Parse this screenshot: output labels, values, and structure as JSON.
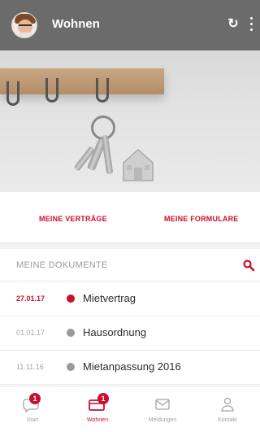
{
  "appbar": {
    "title": "Wohnen",
    "refresh_icon": "refresh-icon",
    "menu_icon": "more-vert-icon"
  },
  "quick_links": {
    "contracts": "MEINE VERTRÄGE",
    "forms": "MEINE FORMULARE"
  },
  "documents": {
    "header": "MEINE DOKUMENTE",
    "search_icon": "search-icon",
    "items": [
      {
        "date": "27.01.17",
        "title": "Mietvertrag",
        "unread": true
      },
      {
        "date": "01.01.17",
        "title": "Hausordnung",
        "unread": false
      },
      {
        "date": "11.11.16",
        "title": "Mietanpassung 2016",
        "unread": false
      }
    ]
  },
  "bottom_nav": {
    "items": [
      {
        "label": "Start",
        "icon": "chat-icon",
        "badge": "1",
        "active": false
      },
      {
        "label": "Wohnen",
        "icon": "folder-icon",
        "badge": "1",
        "active": true
      },
      {
        "label": "Meldungen",
        "icon": "mail-icon",
        "badge": "",
        "active": false
      },
      {
        "label": "Kontakt",
        "icon": "person-icon",
        "badge": "",
        "active": false
      }
    ]
  },
  "colors": {
    "brand_red": "#c8102e",
    "appbar": "#6b6b6b",
    "muted_text": "#9a9a9a",
    "read_dot": "#9a9a9a"
  }
}
